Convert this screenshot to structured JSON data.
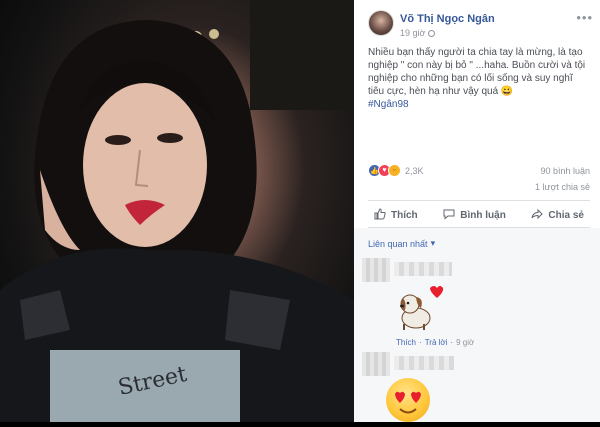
{
  "post": {
    "author": "Võ Thị Ngọc Ngân",
    "time": "19 giờ",
    "text": "Nhiều bạn thấy người ta chia tay là mừng, là tạo nghiệp \" con này bị bỏ \" ...haha. Buồn cười và tội nghiệp cho những bạn có lối sống và suy nghĩ tiêu cực, hèn hạ như vậy quá 😀",
    "hashtag": "#Ngân98",
    "reaction_count": "2,3K",
    "comments_count": "90 bình luận",
    "shares_count": "1 lượt chia sẻ"
  },
  "actions": {
    "like": "Thích",
    "comment": "Bình luận",
    "share": "Chia sẻ"
  },
  "comments": {
    "sort_label": "Liên quan nhất",
    "first": {
      "like_label": "Thích",
      "reply_label": "Trả lời",
      "time": "9 giờ"
    }
  },
  "icons": {
    "more": "more-icon",
    "globe": "globe-icon",
    "like": "thumbs-up-icon",
    "comment": "speech-bubble-icon",
    "share": "share-arrow-icon",
    "reactions": [
      "like-reaction-icon",
      "love-reaction-icon",
      "haha-reaction-icon"
    ]
  },
  "colors": {
    "link": "#365899",
    "accent": "#4267b2",
    "text": "#4b4f56",
    "muted": "#90949c",
    "love": "#f33e58"
  }
}
